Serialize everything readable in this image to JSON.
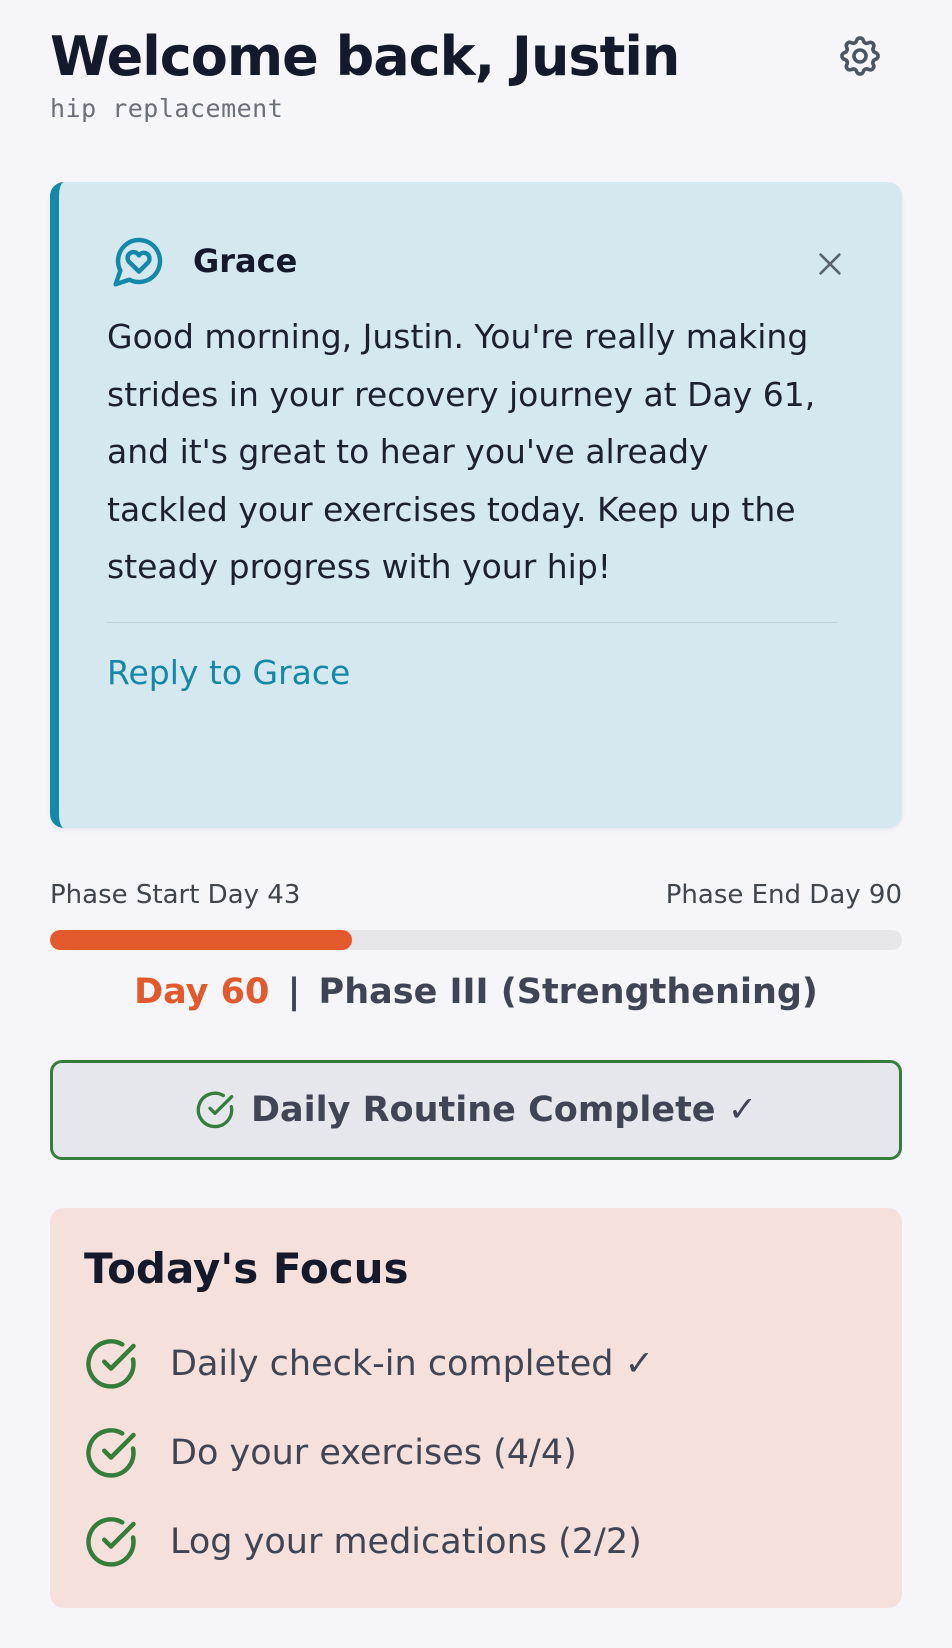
{
  "header": {
    "welcome": "Welcome back, Justin",
    "condition": "hip replacement",
    "settings_icon": "gear-icon"
  },
  "grace": {
    "name": "Grace",
    "icon": "heart-chat-icon",
    "message": "Good morning, Justin. You're really making strides in your recovery journey at Day 61, and it's great to hear you've already tackled your exercises today. Keep up the steady progress with your hip!",
    "reply_label": "Reply to Grace",
    "accent_color": "#1488a8"
  },
  "progress": {
    "start_label": "Phase Start Day 43",
    "end_label": "Phase End Day 90",
    "fraction": 0.355,
    "day_label": "Day 60",
    "separator": "|",
    "phase_label": "Phase III (Strengthening)",
    "accent_color": "#e25a2c"
  },
  "routine": {
    "label": "Daily Routine Complete ✓",
    "icon": "check-circle-icon",
    "status_color": "#347d3a"
  },
  "focus": {
    "title": "Today's Focus",
    "items": [
      {
        "label": "Daily check-in completed ✓",
        "icon": "check-circle-icon"
      },
      {
        "label": "Do your exercises (4/4)",
        "icon": "check-circle-icon"
      },
      {
        "label": "Log your medications (2/2)",
        "icon": "check-circle-icon"
      }
    ]
  }
}
